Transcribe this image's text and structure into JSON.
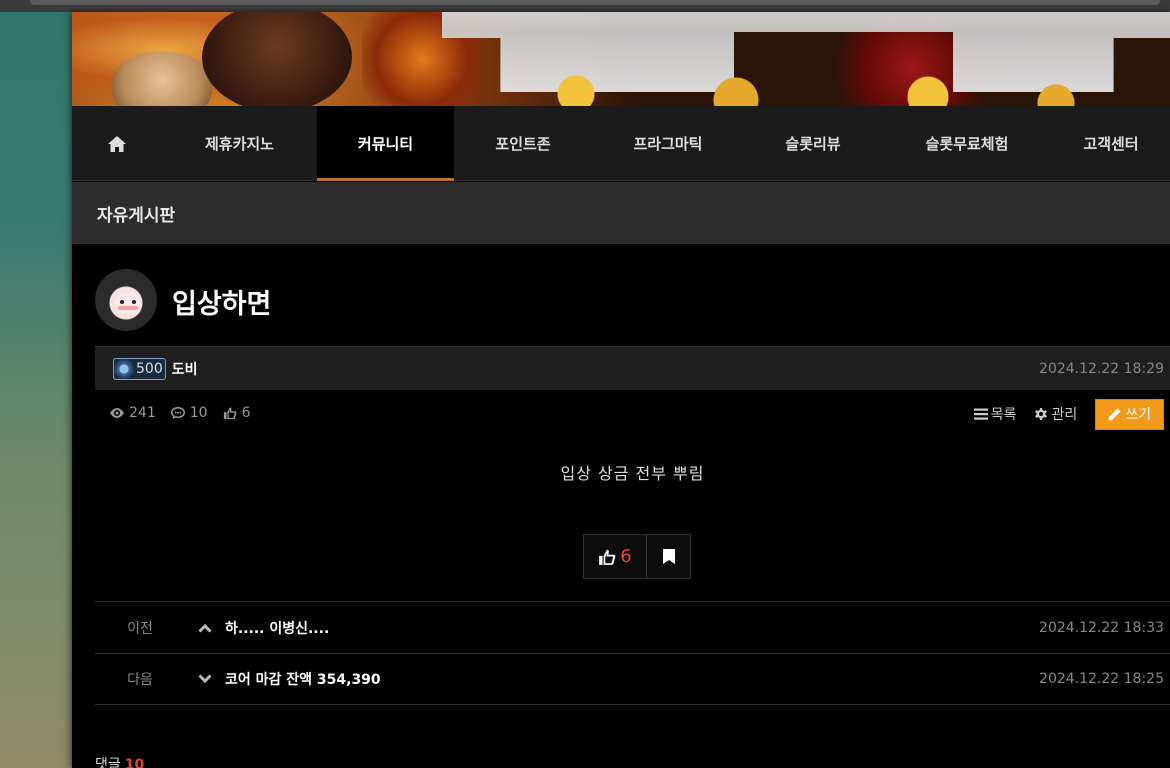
{
  "nav": {
    "items": [
      {
        "label": "제휴카지노"
      },
      {
        "label": "커뮤니티"
      },
      {
        "label": "포인트존"
      },
      {
        "label": "프라그마틱"
      },
      {
        "label": "슬롯리뷰"
      },
      {
        "label": "슬롯무료체험"
      },
      {
        "label": "고객센터"
      }
    ],
    "active_index": 1
  },
  "board": {
    "title": "자유게시판"
  },
  "post": {
    "title": "입상하면",
    "author": {
      "level": "500",
      "name": "도비"
    },
    "date": "2024.12.22 18:29",
    "views": "241",
    "comments": "10",
    "likes": "6",
    "body": "입상 상금 전부 뿌림"
  },
  "actions": {
    "list_label": "목록",
    "manage_label": "관리",
    "write_label": "쓰기"
  },
  "vote": {
    "like_count": "6"
  },
  "prev": {
    "label": "이전",
    "title": "하..... 이병신....",
    "date": "2024.12.22 18:33"
  },
  "next": {
    "label": "다음",
    "title": "코어 마감 잔액 354,390",
    "date": "2024.12.22 18:25"
  },
  "comment_section": {
    "label": "댓글",
    "count": "10"
  },
  "colors": {
    "accent": "#f29b1a",
    "highlight": "#e6452a",
    "nav_underline": "#b8732a"
  }
}
